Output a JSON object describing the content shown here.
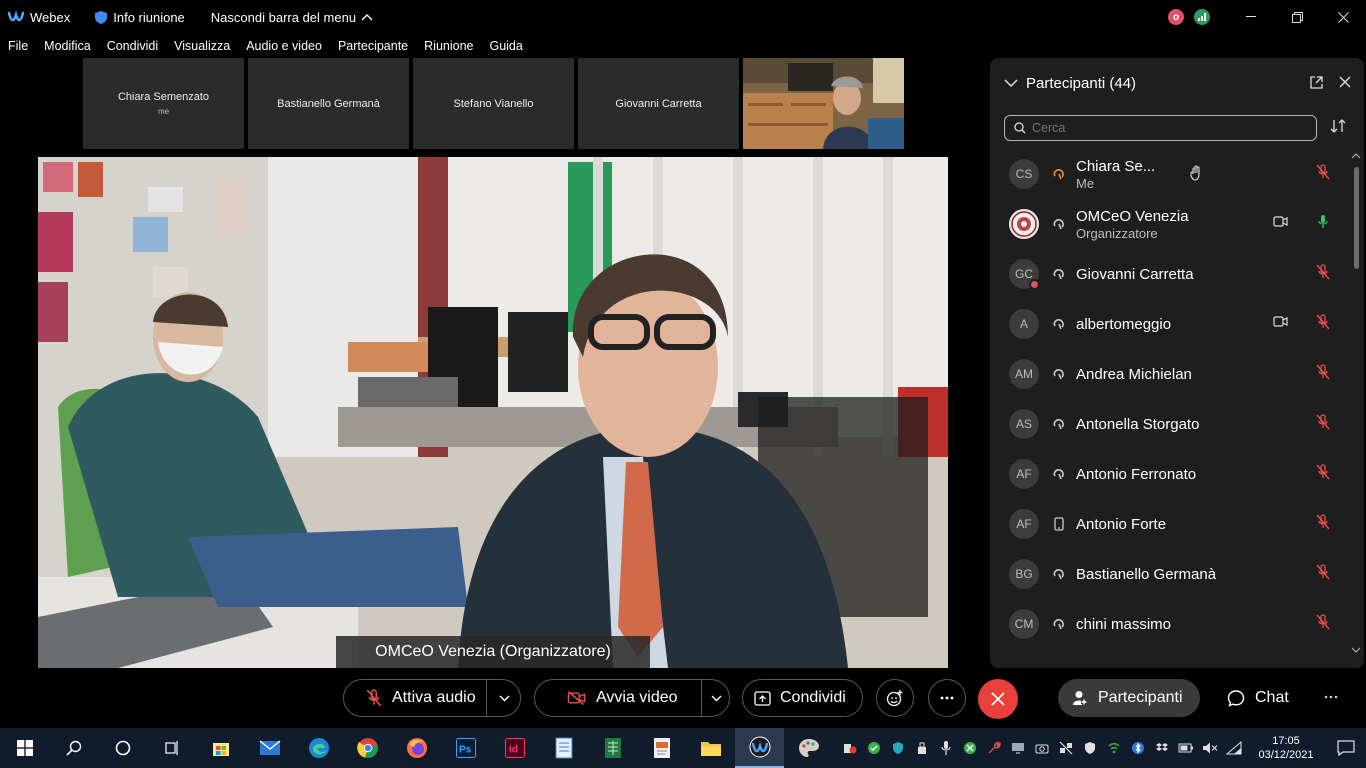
{
  "titlebar": {
    "app_name": "Webex",
    "meeting_info": "Info riunione",
    "hide_menu": "Nascondi barra del menu"
  },
  "menu": [
    "File",
    "Modifica",
    "Condividi",
    "Visualizza",
    "Audio e video",
    "Partecipante",
    "Riunione",
    "Guida"
  ],
  "filmstrip": [
    {
      "name": "Chiara Semenzato",
      "sub": "me"
    },
    {
      "name": "Bastianello Germanà",
      "sub": ""
    },
    {
      "name": "Stefano Vianello",
      "sub": ""
    },
    {
      "name": "Giovanni Carretta",
      "sub": ""
    }
  ],
  "main_video": {
    "label": "OMCeO Venezia (Organizzatore)"
  },
  "participants_panel": {
    "title": "Partecipanti (44)",
    "search_placeholder": "Cerca",
    "rows": [
      {
        "initials": "CS",
        "name": "Chiara Se...",
        "sub": "Me",
        "hand": true,
        "camera": false,
        "mic": "muted"
      },
      {
        "initials": "",
        "name": "OMCeO Venezia",
        "sub": "Organizzatore",
        "hand": false,
        "camera": true,
        "mic": "on"
      },
      {
        "initials": "GC",
        "name": "Giovanni Carretta",
        "sub": "",
        "hand": false,
        "camera": false,
        "mic": "muted"
      },
      {
        "initials": "A",
        "name": "albertomeggio",
        "sub": "",
        "hand": false,
        "camera": true,
        "mic": "muted"
      },
      {
        "initials": "AM",
        "name": "Andrea Michielan",
        "sub": "",
        "hand": false,
        "camera": false,
        "mic": "muted"
      },
      {
        "initials": "AS",
        "name": "Antonella Storgato",
        "sub": "",
        "hand": false,
        "camera": false,
        "mic": "muted"
      },
      {
        "initials": "AF",
        "name": "Antonio Ferronato",
        "sub": "",
        "hand": false,
        "camera": false,
        "mic": "muted"
      },
      {
        "initials": "AF",
        "name": "Antonio Forte",
        "sub": "",
        "hand": false,
        "camera": false,
        "mic": "muted"
      },
      {
        "initials": "BG",
        "name": "Bastianello Germanà",
        "sub": "",
        "hand": false,
        "camera": false,
        "mic": "muted"
      },
      {
        "initials": "CM",
        "name": "chini massimo",
        "sub": "",
        "hand": false,
        "camera": false,
        "mic": "muted"
      }
    ]
  },
  "controls": {
    "audio": "Attiva audio",
    "video": "Avvia video",
    "share": "Condividi",
    "participants": "Partecipanti",
    "chat": "Chat"
  },
  "taskbar": {
    "time": "17:05",
    "date": "03/12/2021"
  },
  "colors": {
    "end_call": "#e8403a",
    "muted_mic": "#e8504a",
    "active_mic": "#3cc16a",
    "hand_raised_status": "#e8923a"
  }
}
